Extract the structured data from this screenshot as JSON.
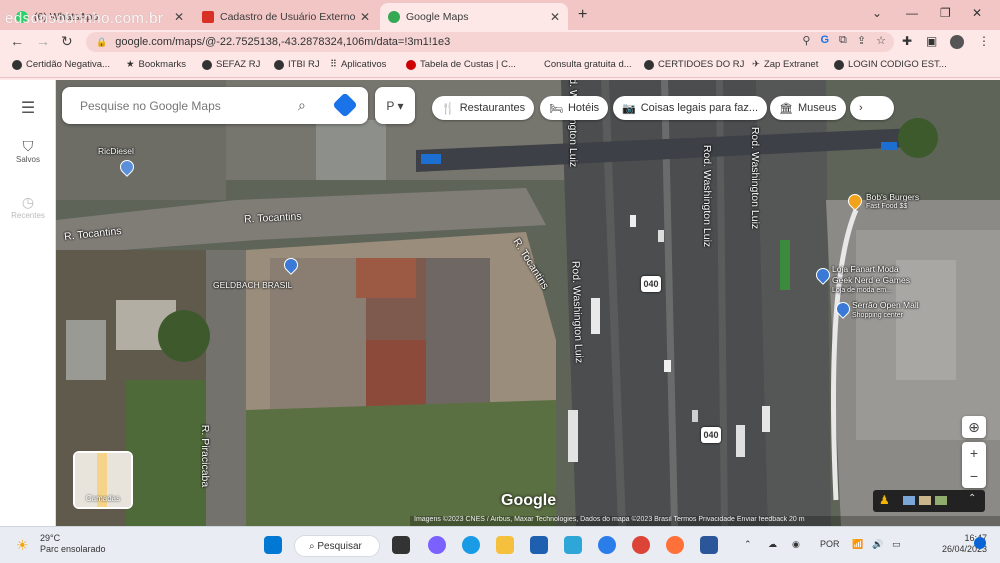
{
  "watermark": "edsonsobrinho.com.br",
  "tabs": [
    {
      "label": "(6) WhatsApp",
      "icon": "whatsapp-icon",
      "color": "#25d366"
    },
    {
      "label": "Cadastro de Usuário Externo no",
      "icon": "gmail-icon",
      "color": "#d93025"
    },
    {
      "label": "Google Maps",
      "icon": "maps-icon",
      "color": "#34a853",
      "active": true
    }
  ],
  "window": {
    "newtab": "+",
    "minimize": "—",
    "restore": "❐",
    "close": "✕",
    "tablist": "⌄"
  },
  "address": {
    "url": "google.com/maps/@-22.7525138,-43.2878324,106m/data=!3m1!1e3"
  },
  "bookmarks": [
    {
      "label": "Certidão Negativa..."
    },
    {
      "label": "Bookmarks"
    },
    {
      "label": "SEFAZ RJ"
    },
    {
      "label": "ITBI RJ"
    },
    {
      "label": "Aplicativos"
    },
    {
      "label": "Tabela de Custas | C..."
    },
    {
      "label": "Consulta gratuita d..."
    },
    {
      "label": "CERTIDOES DO RJ"
    },
    {
      "label": "Zap Extranet"
    },
    {
      "label": "LOGIN CODIGO EST..."
    }
  ],
  "rail": {
    "saved": "Salvos",
    "recent": "Recentes"
  },
  "search": {
    "placeholder": "Pesquise no Google Maps"
  },
  "chips": [
    {
      "label": "Restaurantes",
      "icon": "fork-knife-icon"
    },
    {
      "label": "Hotéis",
      "icon": "bed-icon"
    },
    {
      "label": "Coisas legais para faz...",
      "icon": "camera-icon"
    },
    {
      "label": "Museus",
      "icon": "museum-icon"
    }
  ],
  "streets": [
    {
      "label": "R. Tocantins"
    },
    {
      "label": "R. Tocantins"
    },
    {
      "label": "R. Tocantins"
    },
    {
      "label": "Rod. Washington Luiz"
    },
    {
      "label": "Rod. Washington Luiz"
    },
    {
      "label": "Rod. Washington Luiz"
    },
    {
      "label": "R. Piracicaba"
    },
    {
      "label": "Rod. Washington Luiz"
    }
  ],
  "shields": [
    "040",
    "040"
  ],
  "pois": [
    {
      "label": "RicDiesel"
    },
    {
      "label": "GELDBACH BRASIL"
    },
    {
      "label": "Bob's Burgers",
      "sub": "Fast Food $$"
    },
    {
      "label": "Loja Fanart Moda",
      "sub": "Geek Nerd e Games",
      "sub2": "Loja de moda em..."
    },
    {
      "label": "Serrão Open Mall",
      "sub": "Shopping center"
    }
  ],
  "layers_label": "Camadas",
  "google_logo": "Google",
  "attribution": "Imagens ©2023 CNES / Airbus, Maxar Technologies, Dados do mapa ©2023   Brasil   Termos   Privacidade   Enviar feedback   20 m",
  "taskbar": {
    "temperature": "29°C",
    "condition": "Parc ensolarado",
    "search": "Pesquisar",
    "language": "POR",
    "time": "16:47",
    "date": "26/04/2023"
  }
}
